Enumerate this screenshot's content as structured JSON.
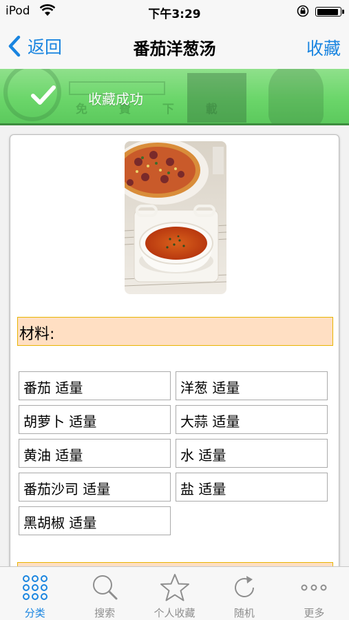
{
  "status_bar": {
    "carrier": "iPod",
    "time": "下午3:29",
    "battery_level": 0.92
  },
  "nav": {
    "back_label": "返回",
    "title": "番茄洋葱汤",
    "action_label": "收藏"
  },
  "toast": {
    "message": "收藏成功",
    "background_text": "免 費 下 載"
  },
  "recipe": {
    "section_title": "材料:",
    "ingredients": [
      "番茄 适量",
      "洋葱 适量",
      "胡萝卜 适量",
      "大蒜 适量",
      "黄油 适量",
      "水 适量",
      "番茄沙司 适量",
      "盐 适量",
      "黑胡椒 适量"
    ]
  },
  "tabs": [
    {
      "label": "分类",
      "icon": "grid-icon",
      "active": true
    },
    {
      "label": "搜索",
      "icon": "search-icon",
      "active": false
    },
    {
      "label": "个人收藏",
      "icon": "star-icon",
      "active": false
    },
    {
      "label": "随机",
      "icon": "refresh-icon",
      "active": false
    },
    {
      "label": "更多",
      "icon": "more-icon",
      "active": false
    }
  ],
  "colors": {
    "accent": "#1a85e0",
    "toast_green": "#6bd66a",
    "section_bg": "#ffdfc3",
    "section_border": "#e8b400"
  }
}
